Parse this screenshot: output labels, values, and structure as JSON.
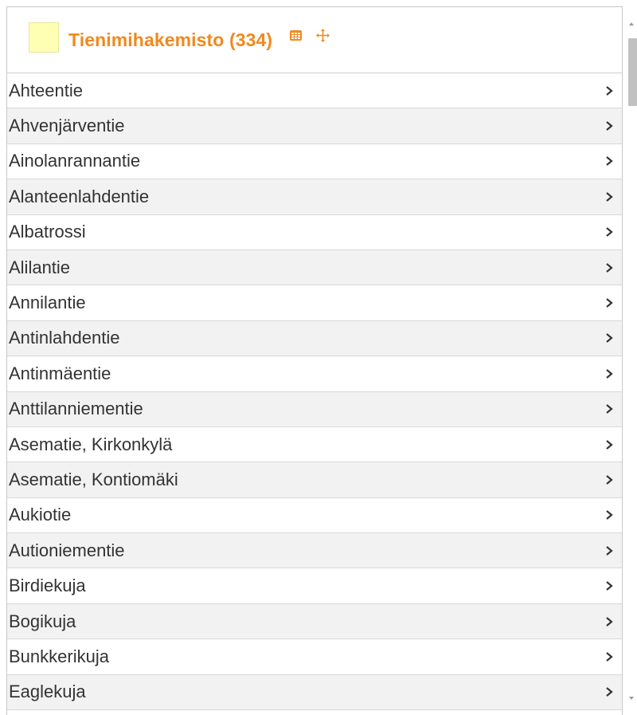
{
  "header": {
    "title": "Tienimihakemisto (334)",
    "swatch_color": "#ffffb3",
    "accent_color": "#f0891e",
    "icons": [
      "table-icon",
      "move-icon"
    ]
  },
  "list": {
    "items": [
      "Ahteentie",
      "Ahvenjärventie",
      "Ainolanrannantie",
      "Alanteenlahdentie",
      "Albatrossi",
      "Alilantie",
      "Annilantie",
      "Antinlahdentie",
      "Antinmäentie",
      "Anttilanniementie",
      "Asematie, Kirkonkylä",
      "Asematie, Kontiomäki",
      "Aukiotie",
      "Autioniementie",
      "Birdiekuja",
      "Bogikuja",
      "Bunkkerikuja",
      "Eaglekuja"
    ],
    "row_icon": "chevron-right-icon"
  }
}
